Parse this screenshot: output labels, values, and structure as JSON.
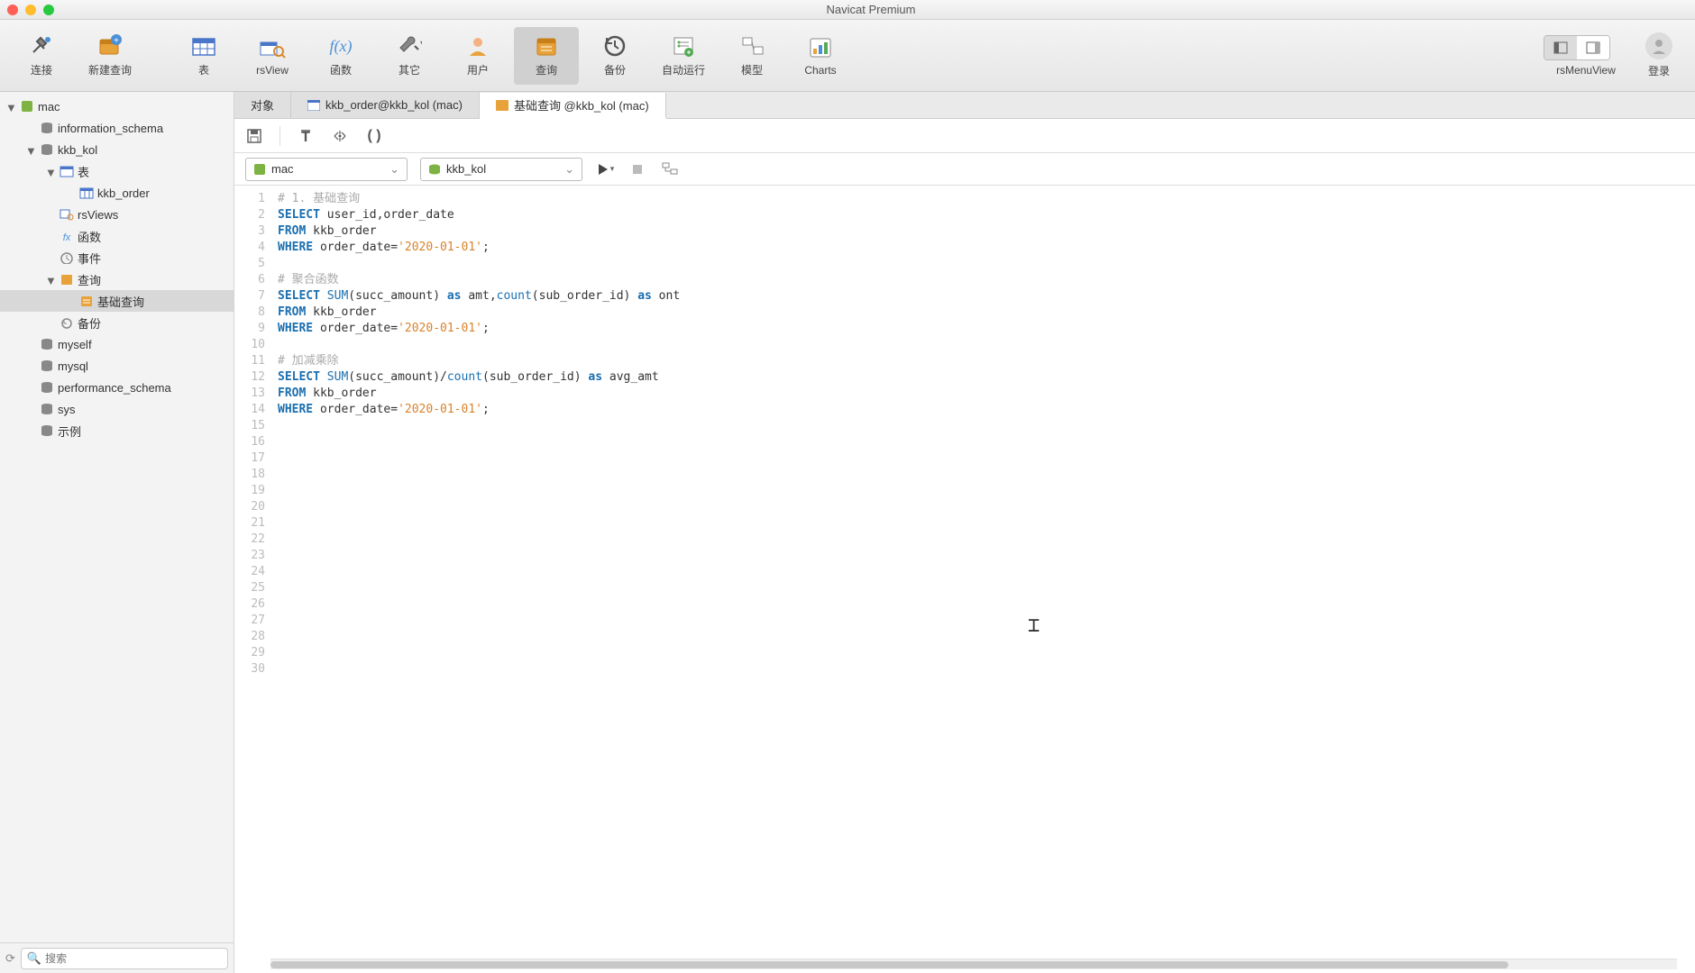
{
  "app_title": "Navicat Premium",
  "toolbar": {
    "connect": "连接",
    "new_query": "新建查询",
    "table": "表",
    "rsview": "rsView",
    "function": "函数",
    "other": "其它",
    "user": "用户",
    "query": "查询",
    "backup": "备份",
    "autorun": "自动运行",
    "model": "模型",
    "charts": "Charts",
    "rsmenuview": "rsMenuView",
    "login": "登录"
  },
  "sidebar": {
    "connection": "mac",
    "items": [
      {
        "label": "information_schema",
        "type": "db"
      },
      {
        "label": "kkb_kol",
        "type": "db",
        "expanded": true,
        "children": [
          {
            "label": "表",
            "type": "folder-table",
            "expanded": true,
            "children": [
              {
                "label": "kkb_order",
                "type": "table"
              }
            ]
          },
          {
            "label": "rsViews",
            "type": "folder-view"
          },
          {
            "label": "函数",
            "type": "folder-fx"
          },
          {
            "label": "事件",
            "type": "folder-event"
          },
          {
            "label": "查询",
            "type": "folder-query",
            "expanded": true,
            "children": [
              {
                "label": "基础查询",
                "type": "query",
                "selected": true
              }
            ]
          },
          {
            "label": "备份",
            "type": "folder-backup"
          }
        ]
      },
      {
        "label": "myself",
        "type": "db"
      },
      {
        "label": "mysql",
        "type": "db"
      },
      {
        "label": "performance_schema",
        "type": "db"
      },
      {
        "label": "sys",
        "type": "db"
      },
      {
        "label": "示例",
        "type": "db"
      }
    ],
    "search_placeholder": "搜索"
  },
  "tabs": [
    {
      "label": "对象"
    },
    {
      "label": "kkb_order@kkb_kol (mac)",
      "icon": "table"
    },
    {
      "label": "基础查询 @kkb_kol (mac)",
      "icon": "query",
      "active": true
    }
  ],
  "editor_dropdowns": {
    "connection": "mac",
    "database": "kkb_kol"
  },
  "code_lines": [
    {
      "n": 1,
      "t": [
        {
          "c": "cm",
          "s": "# 1. 基础查询"
        }
      ]
    },
    {
      "n": 2,
      "t": [
        {
          "c": "kw",
          "s": "SELECT"
        },
        {
          "s": " user_id,order_date"
        }
      ]
    },
    {
      "n": 3,
      "t": [
        {
          "c": "kw",
          "s": "FROM"
        },
        {
          "s": " kkb_order"
        }
      ]
    },
    {
      "n": 4,
      "t": [
        {
          "c": "kw",
          "s": "WHERE"
        },
        {
          "s": " order_date="
        },
        {
          "c": "str",
          "s": "'2020-01-01'"
        },
        {
          "s": ";"
        }
      ]
    },
    {
      "n": 5,
      "t": []
    },
    {
      "n": 6,
      "t": [
        {
          "c": "cm",
          "s": "# 聚合函数"
        }
      ]
    },
    {
      "n": 7,
      "t": [
        {
          "c": "kw",
          "s": "SELECT"
        },
        {
          "s": " "
        },
        {
          "c": "fn",
          "s": "SUM"
        },
        {
          "s": "(succ_amount) "
        },
        {
          "c": "kw",
          "s": "as"
        },
        {
          "s": " amt,"
        },
        {
          "c": "fn",
          "s": "count"
        },
        {
          "s": "(sub_order_id) "
        },
        {
          "c": "kw",
          "s": "as"
        },
        {
          "s": " ont"
        }
      ]
    },
    {
      "n": 8,
      "t": [
        {
          "c": "kw",
          "s": "FROM"
        },
        {
          "s": " kkb_order"
        }
      ]
    },
    {
      "n": 9,
      "t": [
        {
          "c": "kw",
          "s": "WHERE"
        },
        {
          "s": " order_date="
        },
        {
          "c": "str",
          "s": "'2020-01-01'"
        },
        {
          "s": ";"
        }
      ]
    },
    {
      "n": 10,
      "t": []
    },
    {
      "n": 11,
      "t": [
        {
          "c": "cm",
          "s": "# 加减乘除"
        }
      ]
    },
    {
      "n": 12,
      "t": [
        {
          "c": "kw",
          "s": "SELECT"
        },
        {
          "s": " "
        },
        {
          "c": "fn",
          "s": "SUM"
        },
        {
          "s": "(succ_amount)/"
        },
        {
          "c": "fn",
          "s": "count"
        },
        {
          "s": "(sub_order_id) "
        },
        {
          "c": "kw",
          "s": "as"
        },
        {
          "s": " avg_amt"
        }
      ]
    },
    {
      "n": 13,
      "t": [
        {
          "c": "kw",
          "s": "FROM"
        },
        {
          "s": " kkb_order"
        }
      ]
    },
    {
      "n": 14,
      "t": [
        {
          "c": "kw",
          "s": "WHERE"
        },
        {
          "s": " order_date="
        },
        {
          "c": "str",
          "s": "'2020-01-01'"
        },
        {
          "s": ";"
        }
      ]
    },
    {
      "n": 15,
      "t": []
    },
    {
      "n": 16,
      "t": []
    },
    {
      "n": 17,
      "t": []
    },
    {
      "n": 18,
      "t": []
    },
    {
      "n": 19,
      "t": []
    },
    {
      "n": 20,
      "t": []
    },
    {
      "n": 21,
      "t": []
    },
    {
      "n": 22,
      "t": []
    },
    {
      "n": 23,
      "t": []
    },
    {
      "n": 24,
      "t": []
    },
    {
      "n": 25,
      "t": []
    },
    {
      "n": 26,
      "t": []
    },
    {
      "n": 27,
      "t": []
    },
    {
      "n": 28,
      "t": []
    },
    {
      "n": 29,
      "t": []
    },
    {
      "n": 30,
      "t": []
    }
  ]
}
